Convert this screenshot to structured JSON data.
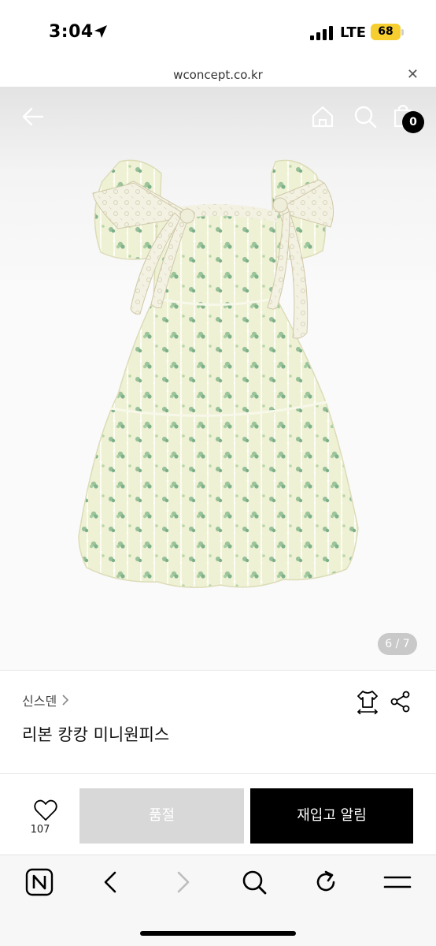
{
  "status_bar": {
    "time": "3:04",
    "network": "LTE",
    "battery": "68"
  },
  "url_bar": {
    "url": "wconcept.co.kr"
  },
  "header": {
    "cart_count": "0"
  },
  "gallery": {
    "counter": "6 / 7"
  },
  "product": {
    "brand": "신스덴",
    "name": "리본 캉캉 미니원피스"
  },
  "actions": {
    "like_count": "107",
    "soldout_label": "품절",
    "restock_label": "재입고 알림"
  },
  "colors": {
    "accent": "#000000",
    "disabled": "#d8d8d8",
    "battery": "#f7ce2f"
  },
  "icons": [
    "location-arrow-icon",
    "signal-icon",
    "close-icon",
    "back-arrow-icon",
    "home-icon",
    "search-icon",
    "shopping-bag-icon",
    "chevron-right-icon",
    "size-guide-icon",
    "share-icon",
    "heart-icon",
    "naver-icon",
    "back-icon",
    "forward-icon",
    "refresh-icon",
    "menu-icon"
  ]
}
